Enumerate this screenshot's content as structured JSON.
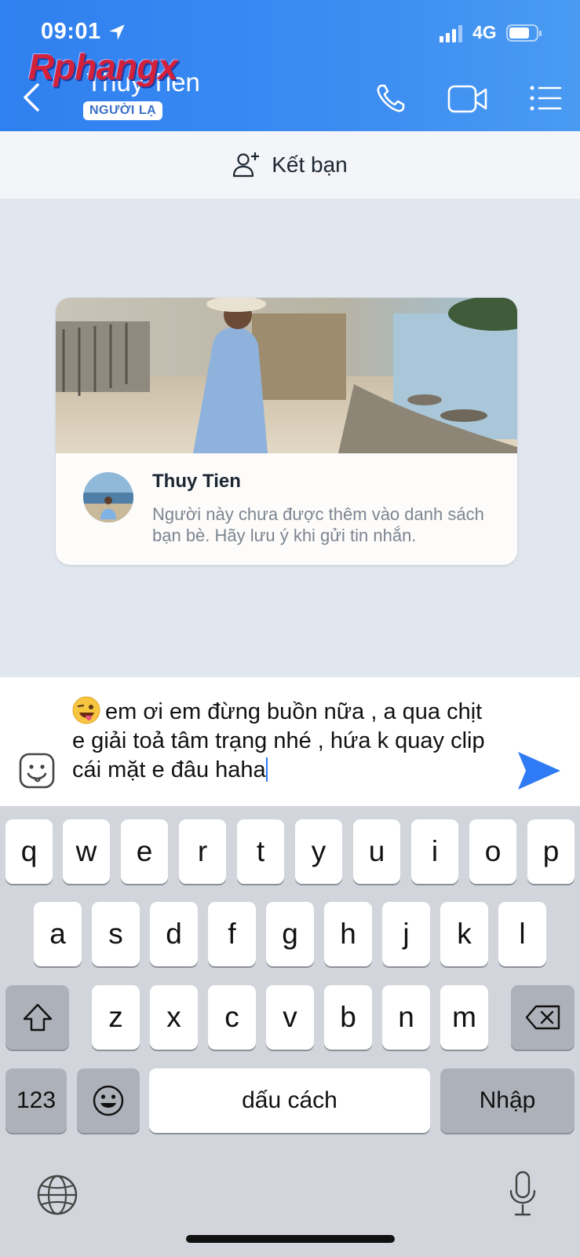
{
  "status_bar": {
    "time": "09:01",
    "network": "4G"
  },
  "watermark": "Rphangx",
  "header": {
    "contact_name": "Thuy Tien",
    "badge": "NGƯỜI LẠ"
  },
  "friend_bar": {
    "label": "Kết bạn"
  },
  "profile_card": {
    "name": "Thuy Tien",
    "note": "Người này chưa được thêm vào danh sách bạn bè. Hãy lưu ý khi gửi tin nhắn."
  },
  "composer": {
    "message": "em ơi em đừng buồn nữa , a qua chịt e giải toả tâm trạng nhé , hứa k quay clip cái mặt e đâu haha"
  },
  "keyboard": {
    "row1": [
      "q",
      "w",
      "e",
      "r",
      "t",
      "y",
      "u",
      "i",
      "o",
      "p"
    ],
    "row2": [
      "a",
      "s",
      "d",
      "f",
      "g",
      "h",
      "j",
      "k",
      "l"
    ],
    "row3": [
      "z",
      "x",
      "c",
      "v",
      "b",
      "n",
      "m"
    ],
    "numbers_key": "123",
    "space_key": "dấu cách",
    "return_key": "Nhập"
  },
  "icons": [
    "location-arrow-icon",
    "signal-icon",
    "battery-icon",
    "back-arrow-icon",
    "phone-icon",
    "video-call-icon",
    "menu-list-icon",
    "add-friend-icon",
    "sticker-icon",
    "send-icon",
    "shift-icon",
    "delete-icon",
    "emoji-icon",
    "globe-icon",
    "microphone-icon"
  ],
  "colors": {
    "header_blue": "#3c8cf2",
    "send_blue": "#2f7bf5",
    "chat_bg": "#e1e7ef"
  }
}
